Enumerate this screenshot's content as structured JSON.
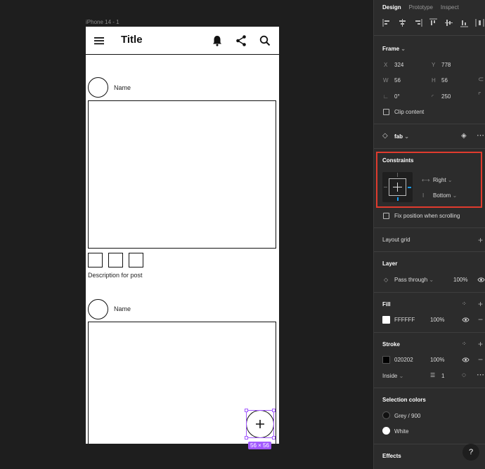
{
  "canvas": {
    "frame_label": "iPhone 14 - 1",
    "app_title": "Title",
    "posts": [
      {
        "name": "Name"
      },
      {
        "name": "Name"
      }
    ],
    "description": "Description for post",
    "selection_size": "56 × 56"
  },
  "panel": {
    "tabs": [
      "Design",
      "Prototype",
      "Inspect"
    ],
    "frame": {
      "title": "Frame",
      "x_label": "X",
      "x": "324",
      "y_label": "Y",
      "y": "778",
      "w_label": "W",
      "w": "56",
      "h_label": "H",
      "h": "56",
      "rotation": "0°",
      "radius": "250",
      "clip_content": "Clip content"
    },
    "component": {
      "name": "fab"
    },
    "constraints": {
      "title": "Constraints",
      "horizontal": "Right",
      "vertical": "Bottom",
      "fix_position": "Fix position when scrolling"
    },
    "layout_grid": "Layout grid",
    "layer": {
      "title": "Layer",
      "mode": "Pass through",
      "opacity": "100%"
    },
    "fill": {
      "title": "Fill",
      "hex": "FFFFFF",
      "opacity": "100%",
      "color": "#ffffff"
    },
    "stroke": {
      "title": "Stroke",
      "hex": "020202",
      "opacity": "100%",
      "color": "#020202",
      "position": "Inside",
      "weight": "1"
    },
    "selection_colors": {
      "title": "Selection colors",
      "items": [
        {
          "name": "Grey / 900",
          "color": "#111111"
        },
        {
          "name": "White",
          "color": "#ffffff"
        }
      ]
    },
    "effects": "Effects",
    "help": "?"
  }
}
